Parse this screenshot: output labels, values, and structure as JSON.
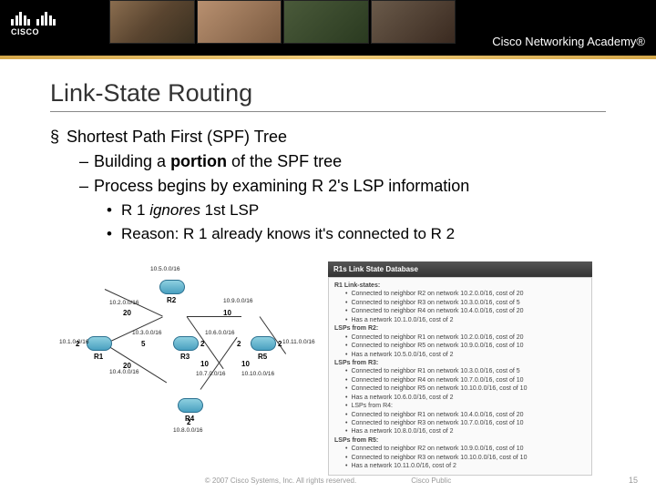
{
  "header": {
    "logo_text": "CISCO",
    "academy": "Cisco Networking Academy®"
  },
  "title": "Link-State Routing",
  "bullets": {
    "l1": "Shortest Path First (SPF) Tree",
    "l2a": "Building a ",
    "l2a_bold": "portion",
    "l2a_after": " of the SPF tree",
    "l2b": "Process begins by examining R 2's LSP information",
    "l3a_pre": "R 1 ",
    "l3a_italic": "ignores",
    "l3a_post": " 1st LSP",
    "l3b": "Reason: R 1 already knows it's connected to R 2"
  },
  "network": {
    "nets": {
      "n1": "10.1.0.0/16",
      "n2": "10.2.0.0/16",
      "n3": "10.3.0.0/16",
      "n4": "10.4.0.0/16",
      "n5": "10.5.0.0/16",
      "n6": "10.6.0.0/16",
      "n7": "10.7.0.0/16",
      "n8": "10.8.0.0/16",
      "n9": "10.9.0.0/16",
      "n10": "10.10.0.0/16",
      "n11": "10.11.0.0/16"
    },
    "routers": {
      "r1": "R1",
      "r2": "R2",
      "r3": "R3",
      "r4": "R4",
      "r5": "R5"
    },
    "costs": {
      "c1": "2",
      "c2": "20",
      "c3": "5",
      "c4": "2",
      "c5": "20",
      "c6": "10",
      "c7": "10",
      "c8": "2",
      "c9": "2",
      "c10": "10",
      "c11": "2"
    }
  },
  "lsdb": {
    "header": "R1s Link State Database",
    "r1_title": "R1 Link-states:",
    "r1": [
      "Connected to neighbor R2 on network 10.2.0.0/16, cost of 20",
      "Connected to neighbor R3 on network 10.3.0.0/16, cost of 5",
      "Connected to neighbor R4 on network 10.4.0.0/16, cost of 20",
      "Has a network 10.1.0.0/16, cost of 2"
    ],
    "r2_title": "LSPs from R2:",
    "r2": [
      "Connected to neighbor R1 on network 10.2.0.0/16, cost of 20",
      "Connected to neighbor R5 on network 10.9.0.0/16, cost of 10",
      "Has a network 10.5.0.0/16, cost of 2"
    ],
    "r3_title": "LSPs from R3:",
    "r3": [
      "Connected to neighbor R1 on network 10.3.0.0/16, cost of 5",
      "Connected to neighbor R4 on network 10.7.0.0/16, cost of 10",
      "Connected to neighbor R5 on network 10.10.0.0/16, cost of 10",
      "Has a network 10.6.0.0/16, cost of 2",
      "LSPs from R4:",
      "Connected to neighbor R1 on network 10.4.0.0/16, cost of 20",
      "Connected to neighbor R3 on network 10.7.0.0/16, cost of 10",
      "Has a network 10.8.0.0/16, cost of 2"
    ],
    "r5_title": "LSPs from R5:",
    "r5": [
      "Connected to neighbor R2 on network 10.9.0.0/16, cost of 10",
      "Connected to neighbor R3 on network 10.10.0.0/16, cost of 10",
      "Has a network 10.11.0.0/16, cost of 2"
    ]
  },
  "footer": {
    "copyright": "© 2007 Cisco Systems, Inc. All rights reserved.",
    "classification": "Cisco Public",
    "page": "15"
  }
}
